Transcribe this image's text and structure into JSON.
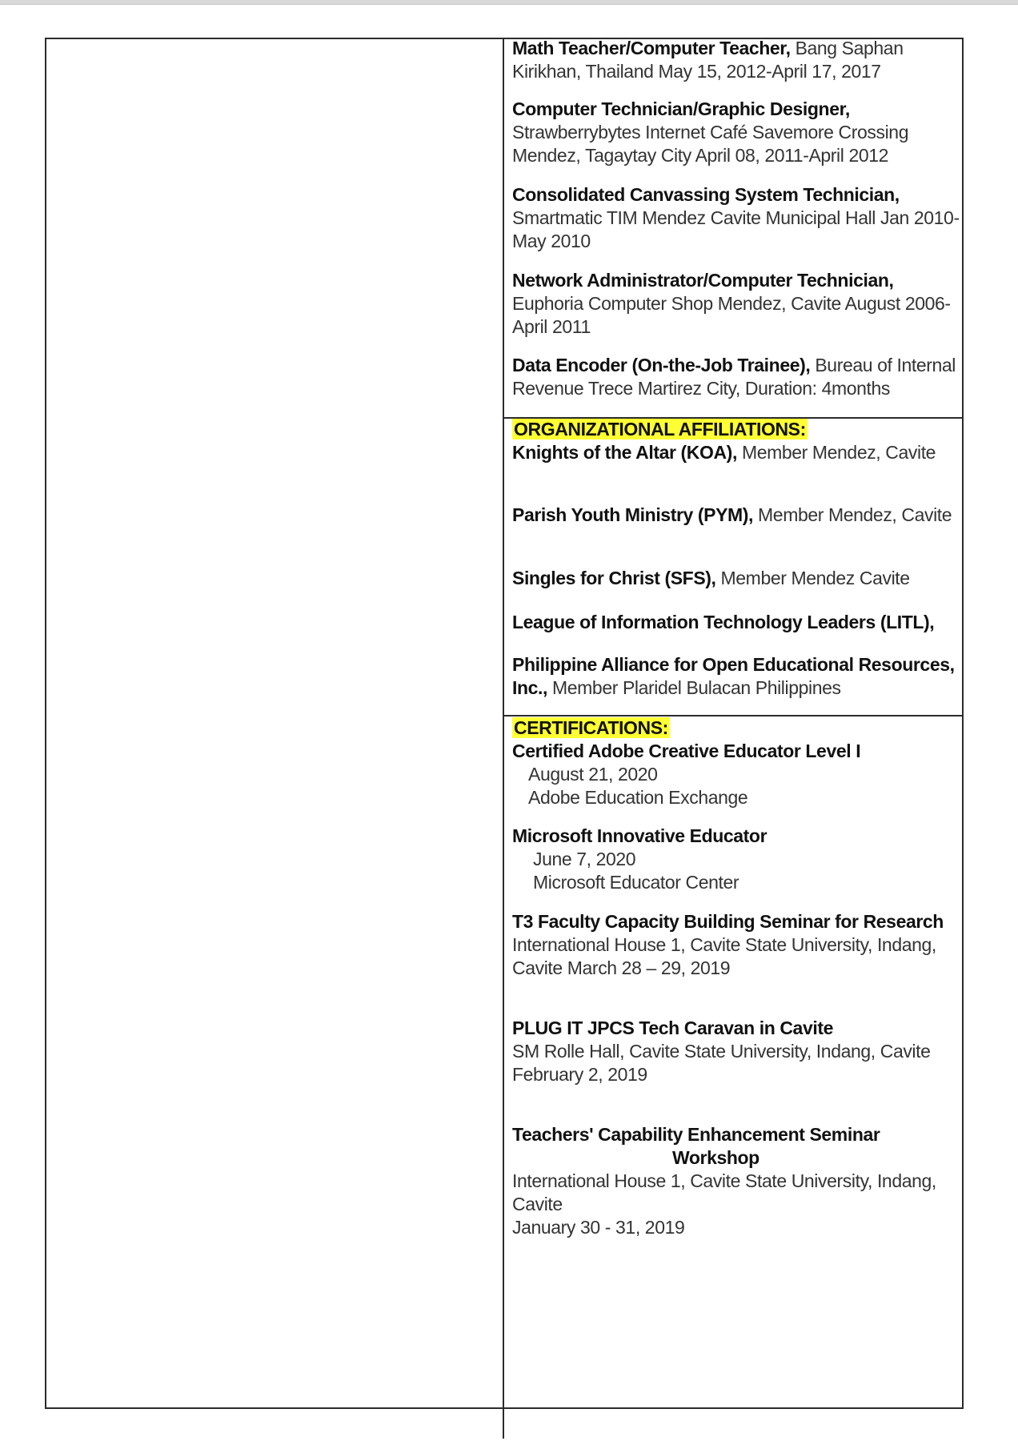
{
  "experience": [
    {
      "title": "Math Teacher/Computer Teacher,",
      "rest": "Bang Saphan Kirikhan, Thailand May 15, 2012-April 17, 2017"
    },
    {
      "title": "Computer Technician/Graphic Designer,",
      "rest": "Strawberrybytes Internet Café Savemore Crossing Mendez, Tagaytay City April 08, 2011-April 2012"
    },
    {
      "title": "Consolidated Canvassing System Technician,",
      "rest": "Smartmatic TIM Mendez Cavite Municipal Hall Jan 2010-May 2010"
    },
    {
      "title": "Network Administrator/Computer Technician,",
      "rest": "Euphoria Computer Shop Mendez, Cavite August 2006-April 2011"
    },
    {
      "title": "Data Encoder (On-the-Job Trainee),",
      "rest": "Bureau of Internal Revenue Trece Martirez City, Duration: 4months"
    }
  ],
  "affiliations": {
    "heading": "ORGANIZATIONAL AFFILIATIONS:",
    "items": [
      {
        "title": "Knights of the Altar (KOA),",
        "rest": "Member Mendez, Cavite"
      },
      {
        "title": "Parish Youth Ministry (PYM),",
        "rest": "Member Mendez, Cavite"
      },
      {
        "title": "Singles for Christ (SFS),",
        "rest": "Member Mendez Cavite"
      },
      {
        "title": "League of Information Technology Leaders (LITL),",
        "rest": ""
      },
      {
        "title": "Philippine Alliance for Open Educational Resources, Inc.,",
        "rest": "Member Plaridel Bulacan Philippines"
      }
    ]
  },
  "certifications": {
    "heading": "CERTIFICATIONS:",
    "items": [
      {
        "title": "Certified Adobe Creative Educator Level I",
        "line1": "August 21, 2020",
        "line2": "Adobe Education Exchange"
      },
      {
        "title": "Microsoft Innovative Educator",
        "line1": "June 7, 2020",
        "line2": "Microsoft Educator Center"
      },
      {
        "title": "T3 Faculty Capacity Building Seminar for Research",
        "line1": "International House 1, Cavite State University, Indang, Cavite March 28 – 29, 2019"
      },
      {
        "title": "PLUG IT JPCS Tech Caravan in Cavite",
        "line1": "SM Rolle Hall, Cavite State University, Indang, Cavite",
        "line2": "February 2, 2019"
      },
      {
        "title": "Teachers' Capability Enhancement Seminar",
        "title2": "Workshop",
        "line1": "International House 1, Cavite State University, Indang, Cavite",
        "line2": "January 30 - 31, 2019"
      }
    ]
  }
}
